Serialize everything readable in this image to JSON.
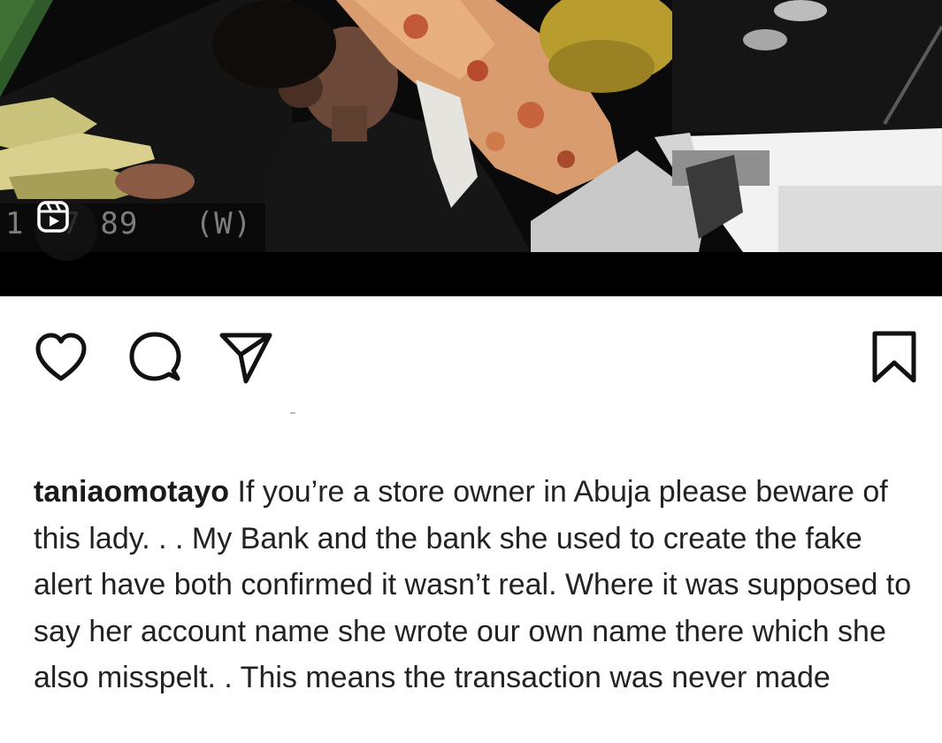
{
  "media": {
    "timestamp_text": "1  7 89   (W)",
    "badge_icon": "reels-icon"
  },
  "actions": {
    "like_icon": "heart-icon",
    "comment_icon": "comment-bubble-icon",
    "share_icon": "paper-plane-icon",
    "save_icon": "bookmark-icon"
  },
  "caption": {
    "username": "taniaomotayo",
    "text": "If you’re a store owner in Abuja please beware of this lady. . . My Bank and the bank she used to create the fake alert have both confirmed it wasn’t real. Where it was supposed to say her account name she wrote our own name there which she also misspelt. . This means the transaction was never made"
  }
}
